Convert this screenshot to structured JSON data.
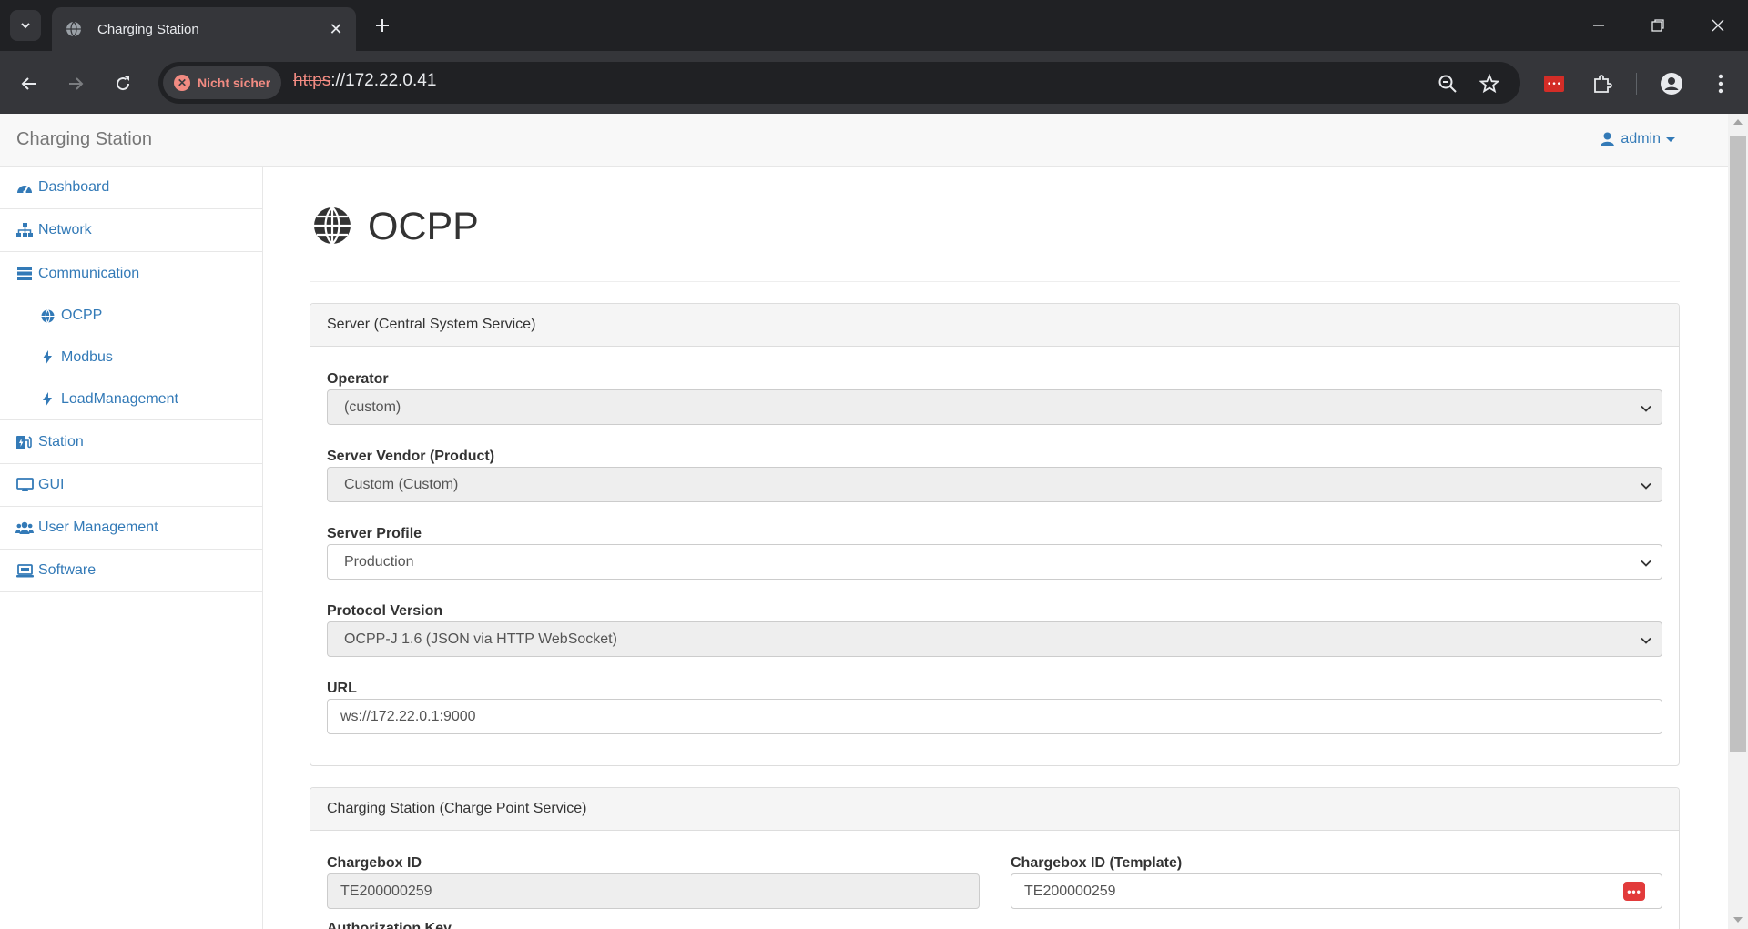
{
  "browser": {
    "tab_title": "Charging Station",
    "security_label": "Nicht sicher",
    "url_scheme": "https",
    "url_rest": "://172.22.0.41"
  },
  "app": {
    "brand": "Charging Station",
    "user": "admin"
  },
  "sidebar": {
    "items": [
      {
        "label": "Dashboard",
        "icon": "dashboard-icon"
      },
      {
        "label": "Network",
        "icon": "sitemap-icon"
      },
      {
        "label": "Communication",
        "icon": "server-icon"
      },
      {
        "label": "Station",
        "icon": "charging-station-icon"
      },
      {
        "label": "GUI",
        "icon": "desktop-icon"
      },
      {
        "label": "User Management",
        "icon": "users-icon"
      },
      {
        "label": "Software",
        "icon": "laptop-icon"
      }
    ],
    "subitems": [
      {
        "label": "OCPP",
        "icon": "globe-icon"
      },
      {
        "label": "Modbus",
        "icon": "bolt-icon"
      },
      {
        "label": "LoadManagement",
        "icon": "bolt-icon"
      }
    ]
  },
  "page": {
    "title": "OCPP"
  },
  "server_panel": {
    "heading": "Server (Central System Service)",
    "operator_label": "Operator",
    "operator_value": "(custom)",
    "vendor_label": "Server Vendor (Product)",
    "vendor_value": "Custom (Custom)",
    "profile_label": "Server Profile",
    "profile_value": "Production",
    "protocol_label": "Protocol Version",
    "protocol_value": "OCPP-J 1.6 (JSON via HTTP WebSocket)",
    "url_label": "URL",
    "url_value": "ws://172.22.0.1:9000"
  },
  "station_panel": {
    "heading": "Charging Station (Charge Point Service)",
    "chargebox_label": "Chargebox ID",
    "chargebox_value": "TE200000259",
    "template_label": "Chargebox ID (Template)",
    "template_value": "TE200000259",
    "auth_label": "Authorization Key"
  },
  "colors": {
    "link": "#337ab7",
    "chrome_dark": "#202124",
    "chrome_toolbar": "#35363a",
    "insecure": "#f28b82"
  }
}
